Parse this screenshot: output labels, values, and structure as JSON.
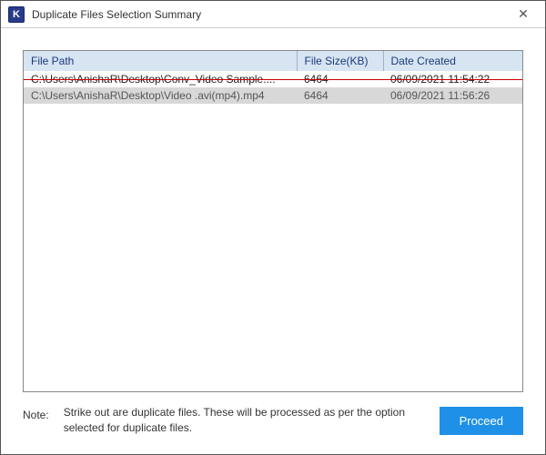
{
  "window": {
    "title": "Duplicate Files Selection Summary",
    "icon_letter": "K"
  },
  "table": {
    "headers": {
      "path": "File Path",
      "size": "File Size(KB)",
      "date": "Date Created"
    },
    "rows": [
      {
        "path": "C:\\Users\\AnishaR\\Desktop\\Conv_Video Sample....",
        "size": "6464",
        "date": "06/09/2021 11:54:22",
        "duplicate": true
      },
      {
        "path": "C:\\Users\\AnishaR\\Desktop\\Video .avi(mp4).mp4",
        "size": "6464",
        "date": "06/09/2021 11:56:26",
        "duplicate": false
      }
    ]
  },
  "footer": {
    "note_label": "Note:",
    "note_text": "Strike out are duplicate files. These will be processed as per the option selected for duplicate files.",
    "proceed_label": "Proceed"
  }
}
